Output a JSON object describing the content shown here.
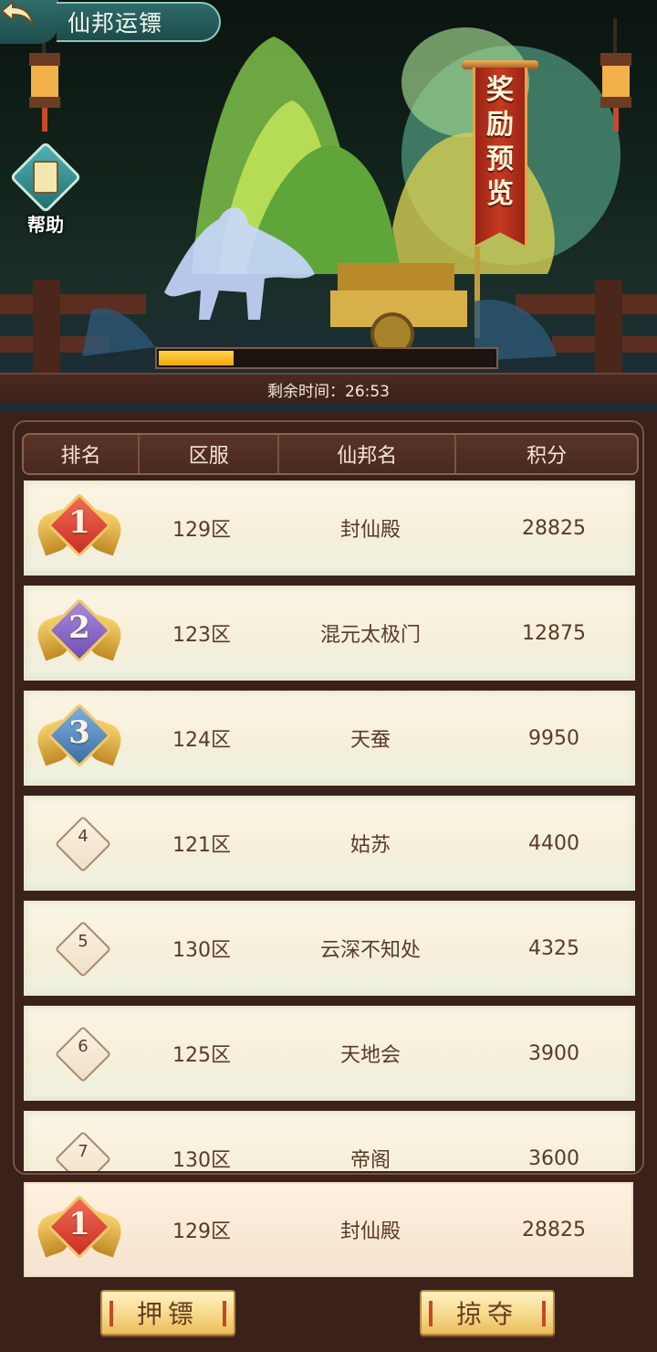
{
  "header": {
    "title": "仙邦运镖",
    "back_icon": "back-arrow-icon"
  },
  "help": {
    "label": "帮助",
    "icon": "book-icon"
  },
  "reward_banner": {
    "text": "奖励预览"
  },
  "progress": {
    "fraction": 0.22
  },
  "timer": {
    "label": "剩余时间：26:53"
  },
  "table": {
    "headers": [
      "排名",
      "区服",
      "仙邦名",
      "积分"
    ],
    "rows": [
      {
        "rank": "1",
        "server": "129区",
        "name": "封仙殿",
        "score": "28825"
      },
      {
        "rank": "2",
        "server": "123区",
        "name": "混元太极门",
        "score": "12875"
      },
      {
        "rank": "3",
        "server": "124区",
        "name": "天蚕",
        "score": "9950"
      },
      {
        "rank": "4",
        "server": "121区",
        "name": "姑苏",
        "score": "4400"
      },
      {
        "rank": "5",
        "server": "130区",
        "name": "云深不知处",
        "score": "4325"
      },
      {
        "rank": "6",
        "server": "125区",
        "name": "天地会",
        "score": "3900"
      },
      {
        "rank": "7",
        "server": "130区",
        "name": "帝阁",
        "score": "3600"
      }
    ]
  },
  "my_rank": {
    "rank": "1",
    "server": "129区",
    "name": "封仙殿",
    "score": "28825"
  },
  "buttons": {
    "escort": "押镖",
    "plunder": "掠夺"
  },
  "colors": {
    "gold": "#f3a80b",
    "rank1": "#e0473a",
    "rank2": "#8a6bc7",
    "rank3": "#5a8bbf",
    "panel": "#3a211a"
  }
}
